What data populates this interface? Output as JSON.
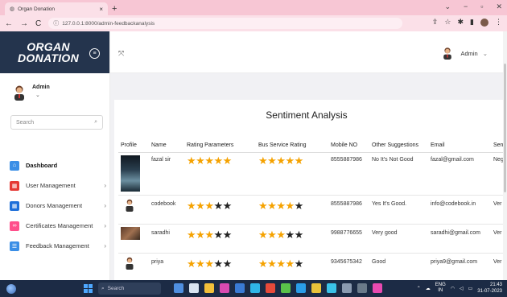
{
  "browser": {
    "tab_title": "Organ Donation",
    "tab_close": "×",
    "new_tab": "+",
    "url": "127.0.0.1:8000/admin-feedbackanalysis",
    "win_min": "−",
    "win_max": "▫",
    "win_close": "✕",
    "win_down": "⌄"
  },
  "sidebar": {
    "brand_line1": "ORGAN",
    "brand_line2": "DONATION",
    "user_name": "Admin",
    "user_chevron": "⌄",
    "search_placeholder": "Search",
    "menu": [
      {
        "label": "Dashboard",
        "color": "#3a8ee6"
      },
      {
        "label": "User Management",
        "color": "#e53935"
      },
      {
        "label": "Donors Management",
        "color": "#1e6fd9"
      },
      {
        "label": "Certificates Management",
        "color": "#ff4f8b"
      },
      {
        "label": "Feedback Management",
        "color": "#3a8ee6"
      }
    ]
  },
  "header": {
    "user_label": "Admin"
  },
  "page": {
    "title": "Sentiment Analysis"
  },
  "table": {
    "columns": [
      "Profile",
      "Name",
      "Rating Parameters",
      "Bus Service Rating",
      "Mobile NO",
      "Other Suggestions",
      "Email",
      "Sen"
    ],
    "rows": [
      {
        "name": "fazal sir",
        "rating": 5,
        "bus": 5,
        "mobile": "8555887986",
        "suggestion": "No It's Not Good",
        "email": "fazal@gmail.com",
        "sen": "Neg"
      },
      {
        "name": "codebook",
        "rating": 3,
        "bus": 4,
        "mobile": "8555887986",
        "suggestion": "Yes It's Good.",
        "email": "info@codebook.in",
        "sen": "Ver"
      },
      {
        "name": "saradhi",
        "rating": 3,
        "bus": 3,
        "mobile": "9988776655",
        "suggestion": "Very good",
        "email": "saradhi@gmail.com",
        "sen": "Ver"
      },
      {
        "name": "priya",
        "rating": 3,
        "bus": 4,
        "mobile": "9345675342",
        "suggestion": "Good",
        "email": "priya9@gmail.com",
        "sen": "Ver"
      }
    ]
  },
  "taskbar": {
    "search_placeholder": "Search",
    "lang1": "ENG",
    "lang2": "IN",
    "time": "21:43",
    "date": "31-07-2023"
  }
}
